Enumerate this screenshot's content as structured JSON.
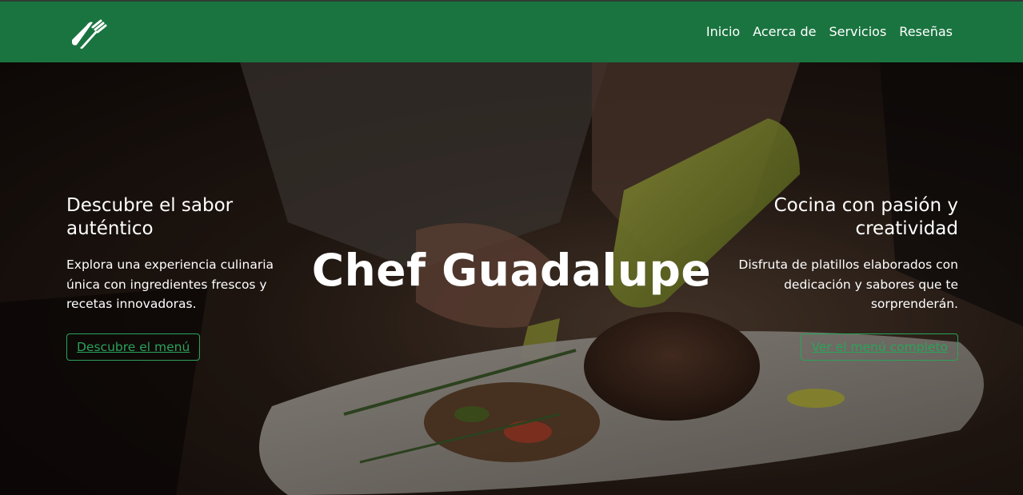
{
  "nav": {
    "logo_icon": "fork-knife-icon",
    "items": [
      {
        "label": "Inicio"
      },
      {
        "label": "Acerca de"
      },
      {
        "label": "Servicios"
      },
      {
        "label": "Reseñas"
      }
    ]
  },
  "hero": {
    "title": "Chef Guadalupe",
    "left": {
      "heading": "Descubre el sabor auténtico",
      "text": "Explora una experiencia culinaria única con ingredientes frescos y recetas innovadoras.",
      "button": "Descubre el menú"
    },
    "right": {
      "heading": "Cocina con pasión y creatividad",
      "text": "Disfruta de platillos elaborados con dedicación y sabores que te sorprenderán.",
      "button": "Ver el menú completo"
    }
  },
  "colors": {
    "navbar": "#1a7440",
    "accent": "#2aa35a",
    "text": "#ffffff"
  }
}
